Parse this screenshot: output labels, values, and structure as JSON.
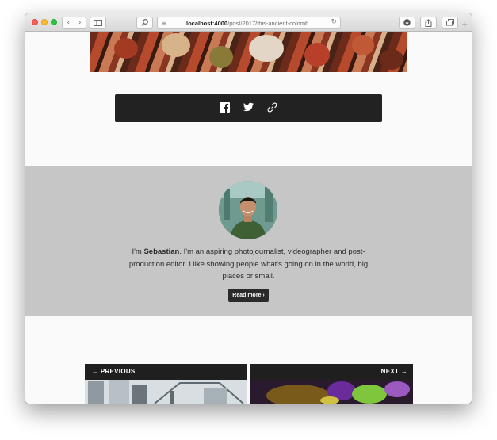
{
  "browser": {
    "url_host": "localhost:4000",
    "url_path": "/post/2017/this-ancient-colomb",
    "back_glyph": "‹",
    "forward_glyph": "›",
    "new_tab_glyph": "+"
  },
  "share": {
    "icons": [
      "facebook-icon",
      "twitter-icon",
      "link-icon"
    ]
  },
  "about": {
    "intro": "I'm",
    "name": "Sebastian",
    "bio": ". I'm an aspiring photojournalist, videographer and post-production editor. I like showing people what's going on in the world, big places or small.",
    "read_more": "Read more ›"
  },
  "post_nav": {
    "previous_label": "← PREVIOUS",
    "next_label": "NEXT →"
  },
  "colors": {
    "share_bar": "#222222",
    "about_bg": "#c6c6c6",
    "nav_card": "#1f1f1f"
  }
}
